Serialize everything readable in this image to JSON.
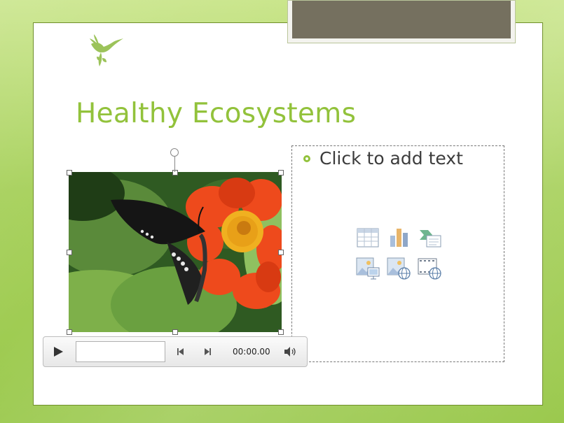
{
  "slide": {
    "title": "Healthy Ecosystems",
    "placeholder_text": "Click to add text"
  },
  "content_icons": [
    "insert-table-icon",
    "insert-chart-icon",
    "insert-smartart-icon",
    "insert-picture-icon",
    "insert-clipart-icon",
    "insert-media-icon"
  ],
  "media_player": {
    "time": "00:00.00",
    "progress": 0
  },
  "colors": {
    "title": "#92c23b",
    "header_bar": "#75705f",
    "background": "#a6d05a"
  }
}
